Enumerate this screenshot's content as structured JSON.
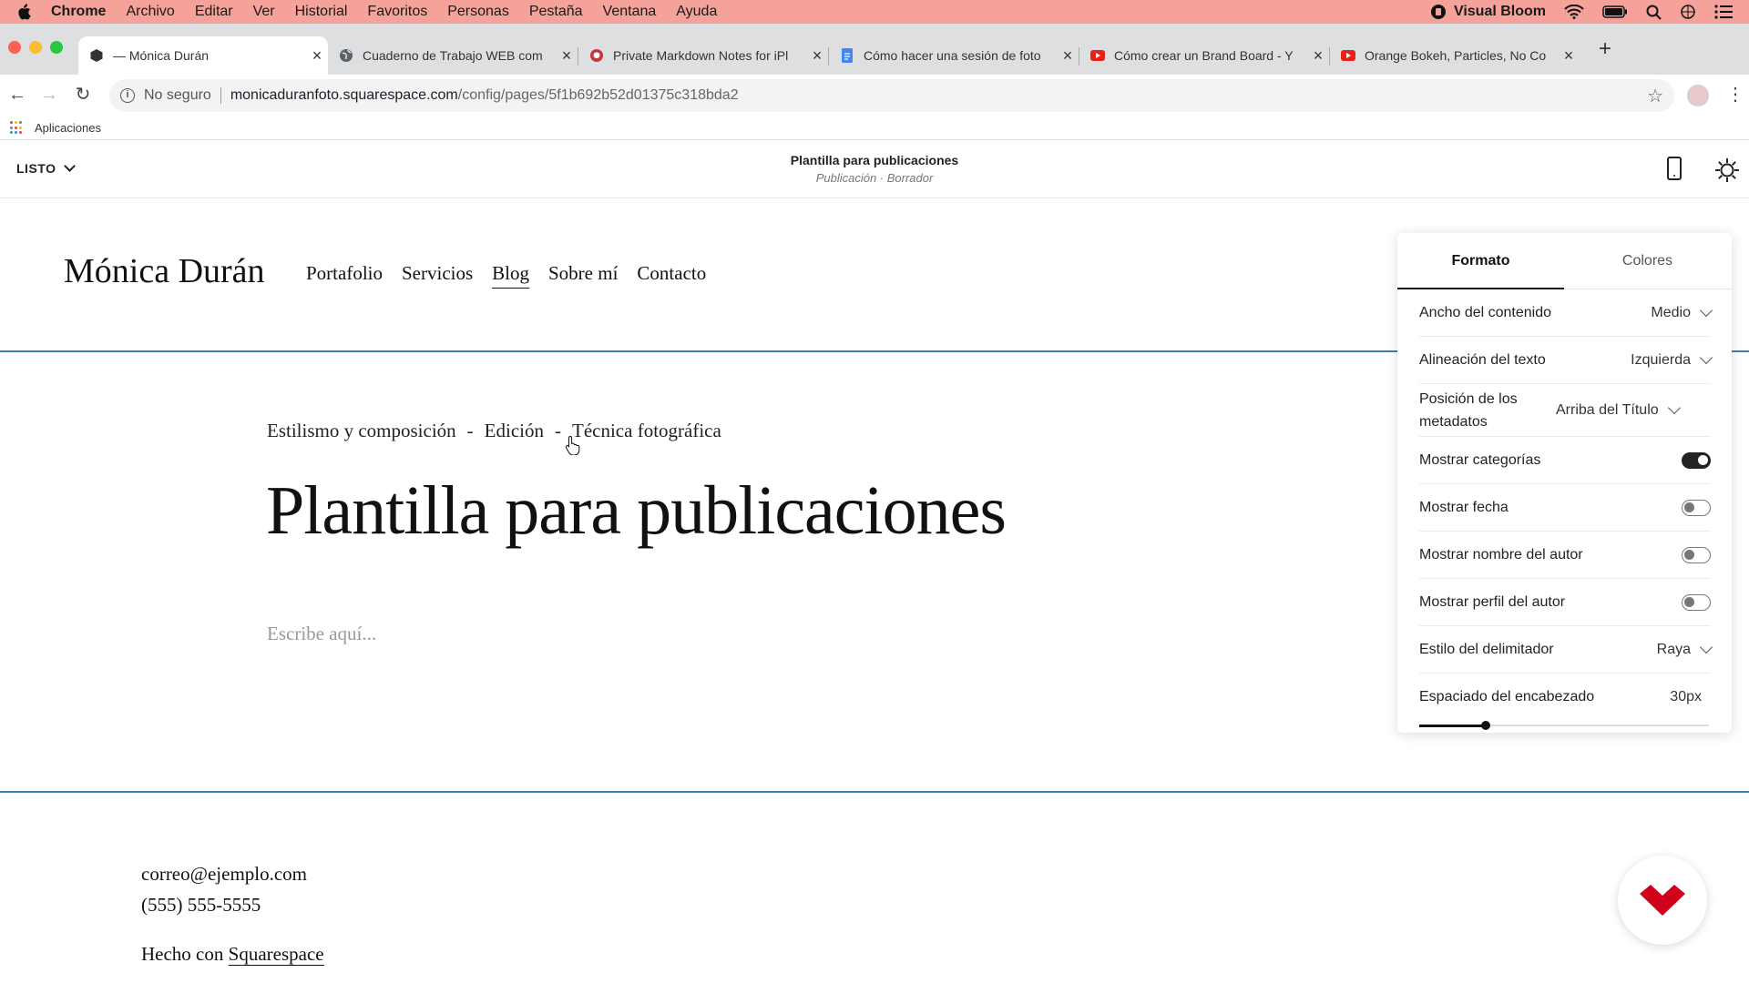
{
  "menubar": {
    "app": "Chrome",
    "items": [
      "Archivo",
      "Editar",
      "Ver",
      "Historial",
      "Favoritos",
      "Personas",
      "Pestaña",
      "Ventana",
      "Ayuda"
    ],
    "status_app": "Visual Bloom",
    "icons": [
      "apple-logo",
      "visual-bloom-icon",
      "wifi-icon",
      "battery-icon",
      "search-icon",
      "siri-icon",
      "control-center-icon"
    ]
  },
  "tabs": [
    {
      "title": "— Mónica Durán",
      "icon": "squarespace-favicon",
      "active": true
    },
    {
      "title": "Cuaderno de Trabajo WEB com",
      "icon": "globe-favicon"
    },
    {
      "title": "Private Markdown Notes for iPl",
      "icon": "bear-favicon"
    },
    {
      "title": "Cómo hacer una sesión de foto",
      "icon": "google-docs-favicon"
    },
    {
      "title": "Cómo crear un Brand Board - Y",
      "icon": "youtube-favicon"
    },
    {
      "title": "Orange Bokeh, Particles, No Co",
      "icon": "youtube-favicon"
    }
  ],
  "address": {
    "security": "No seguro",
    "domain": "monicaduranfoto.squarespace.com",
    "path": "/config/pages/5f1b692b52d01375c318bda2"
  },
  "bookmarks": {
    "apps_label": "Aplicaciones"
  },
  "editor": {
    "done_label": "LISTO",
    "page_title": "Plantilla para publicaciones",
    "page_status": "Publicación · Borrador"
  },
  "site": {
    "logo": "Mónica Durán",
    "nav": [
      "Portafolio",
      "Servicios",
      "Blog",
      "Sobre mí",
      "Contacto"
    ],
    "active_nav": "Blog",
    "categories": [
      "Estilismo y composición",
      "-",
      "Edición",
      "-",
      "Técnica fotográfica"
    ],
    "post_title": "Plantilla para publicaciones",
    "body_placeholder": "Escribe aquí...",
    "footer": {
      "email": "correo@ejemplo.com",
      "phone": "(555) 555-5555",
      "made_prefix": "Hecho con ",
      "made_link": "Squarespace"
    }
  },
  "panel": {
    "tabs": [
      "Formato",
      "Colores"
    ],
    "active_tab": "Formato",
    "rows": [
      {
        "label": "Ancho del contenido",
        "type": "select",
        "value": "Medio"
      },
      {
        "label": "Alineación del texto",
        "type": "select",
        "value": "Izquierda"
      },
      {
        "label": "Posición de los metadatos",
        "type": "select",
        "value": "Arriba del Título"
      },
      {
        "label": "Mostrar categorías",
        "type": "toggle",
        "on": true
      },
      {
        "label": "Mostrar fecha",
        "type": "toggle",
        "on": false
      },
      {
        "label": "Mostrar nombre del autor",
        "type": "toggle",
        "on": false
      },
      {
        "label": "Mostrar perfil del autor",
        "type": "toggle",
        "on": false
      },
      {
        "label": "Estilo del delimitador",
        "type": "select",
        "value": "Raya"
      },
      {
        "label": "Espaciado del encabezado",
        "type": "slider",
        "value": "30px",
        "fraction": 0.23
      }
    ]
  },
  "colors": {
    "menubar": "#f4a29a",
    "accent_line": "#3d7fae",
    "youtube": "#e62117",
    "domestika": "#d0021b",
    "docs": "#4285f4"
  }
}
